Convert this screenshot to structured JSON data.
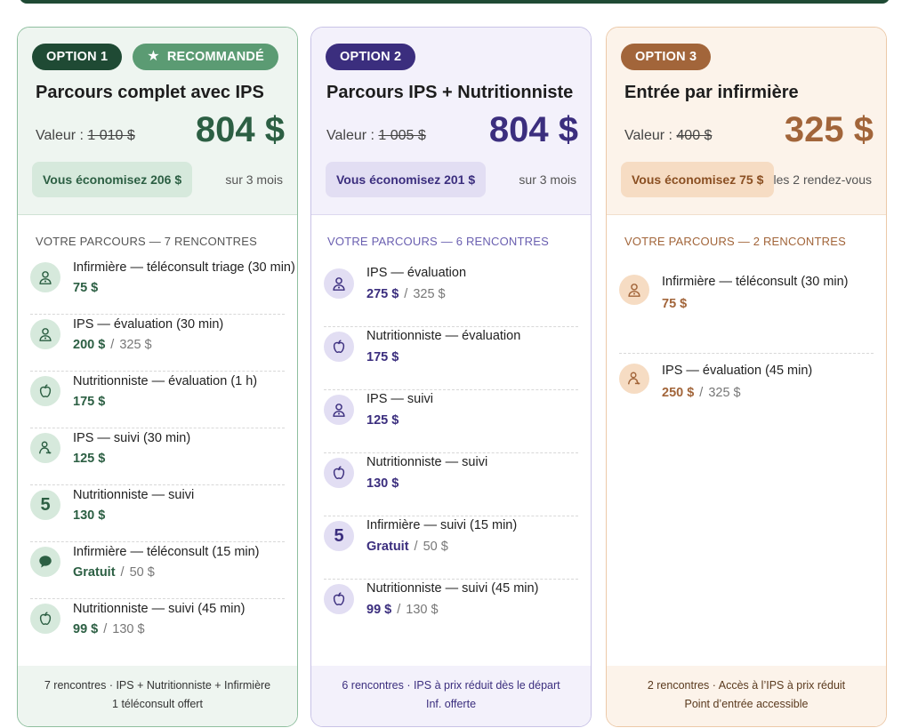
{
  "colors": {
    "green": "#2c5f43",
    "green_dark": "#1f4a34",
    "green_light": "#5b9b73",
    "green_bg": "#d6e9dc",
    "purple": "#3b2e7e",
    "purple_bg": "#e2def3",
    "brown": "#a2653a",
    "brown_bg": "#f6dcc3"
  },
  "cards": [
    {
      "badge": "OPTION 1",
      "badge_rec": "RECOMMANDÉ",
      "title": "Parcours complet avec IPS",
      "valeur_label": "Valeur :",
      "valeur_old": "1 010 $",
      "price": "804 $",
      "save": "Vous économisez 206 $",
      "period": "sur 3 mois",
      "parcours": "VOTRE PARCOURS — 7 RENCONTRES",
      "items": [
        {
          "icon": "nurse-icon",
          "name": "Infirmière — téléconsult triage (30 min)",
          "price": "75 $",
          "ref": ""
        },
        {
          "icon": "nurse-icon",
          "name": "IPS — évaluation (30 min)",
          "price": "200 $",
          "ref": "325 $"
        },
        {
          "icon": "apple-icon",
          "name": "Nutritionniste — évaluation (1 h)",
          "price": "175 $",
          "ref": ""
        },
        {
          "icon": "person-icon",
          "name": "IPS — suivi (30 min)",
          "price": "125 $",
          "ref": ""
        },
        {
          "icon": "five-icon",
          "name": "Nutritionniste — suivi",
          "price": "130 $",
          "ref": ""
        },
        {
          "icon": "chat-icon",
          "name": "Infirmière — téléconsult (15 min)",
          "price": "Gratuit",
          "ref": "50 $"
        },
        {
          "icon": "apple-icon",
          "name": "Nutritionniste — suivi (45 min)",
          "price": "99 $",
          "ref": "130 $"
        }
      ],
      "foot1": "7 rencontres  ·  IPS + Nutritionniste + Infirmière",
      "foot2": "1 téléconsult offert"
    },
    {
      "badge": "OPTION 2",
      "title": "Parcours IPS + Nutritionniste",
      "valeur_label": "Valeur :",
      "valeur_old": "1 005 $",
      "price": "804 $",
      "save": "Vous économisez 201 $",
      "period": "sur 3 mois",
      "parcours": "VOTRE PARCOURS — 6 RENCONTRES",
      "items": [
        {
          "icon": "nurse-icon",
          "name": "IPS — évaluation",
          "price": "275 $",
          "ref": "325 $"
        },
        {
          "icon": "apple-icon",
          "name": "Nutritionniste — évaluation",
          "price": "175 $",
          "ref": ""
        },
        {
          "icon": "nurse-icon",
          "name": "IPS — suivi",
          "price": "125 $",
          "ref": ""
        },
        {
          "icon": "apple-icon",
          "name": "Nutritionniste — suivi",
          "price": "130 $",
          "ref": ""
        },
        {
          "icon": "five-icon",
          "name": "Infirmière — suivi (15 min)",
          "price": "Gratuit",
          "ref": "50 $"
        },
        {
          "icon": "apple-icon",
          "name": "Nutritionniste — suivi (45 min)",
          "price": "99 $",
          "ref": "130 $"
        }
      ],
      "foot1": "6 rencontres  ·  IPS à prix réduit dès le départ",
      "foot2": "Inf. offerte"
    },
    {
      "badge": "OPTION 3",
      "title": "Entrée par infirmière",
      "valeur_label": "Valeur :",
      "valeur_old": "400 $",
      "price": "325 $",
      "save": "Vous économisez 75 $",
      "period": "les 2 rendez-vous",
      "parcours": "VOTRE PARCOURS — 2 RENCONTRES",
      "items": [
        {
          "icon": "nurse-icon",
          "name": "Infirmière — téléconsult (30 min)",
          "price": "75 $",
          "ref": ""
        },
        {
          "icon": "person-icon",
          "name": "IPS — évaluation (45 min)",
          "price": "250 $",
          "ref": "325 $"
        }
      ],
      "foot1": "2 rencontres  ·  Accès à l’IPS à prix réduit",
      "foot2": "Point d’entrée accessible"
    }
  ]
}
